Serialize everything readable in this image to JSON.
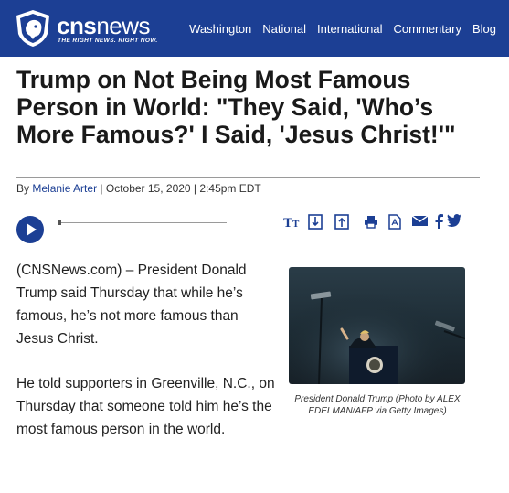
{
  "header": {
    "logo_text_bold": "cns",
    "logo_text_light": "news",
    "tagline": "THE RIGHT NEWS. RIGHT NOW.",
    "background_color": "#1c3f94",
    "nav": [
      "Washington",
      "National",
      "International",
      "Commentary",
      "Blog"
    ]
  },
  "article": {
    "title": "Trump on Not Being Most Famous Person in World: \"They Said, 'Who’s More Famous?' I Said, 'Jesus Christ!'\"",
    "byline_prefix": "By",
    "author": "Melanie Arter",
    "date_sep": " | ",
    "date": "October 15, 2020",
    "time_sep": " | ",
    "time": "2:45pm EDT",
    "paragraphs": [
      "(CNSNews.com) – President Donald Trump said Thursday that while he’s famous, he’s not more famous than Jesus Christ.",
      "He told supporters in Greenville, N.C., on Thursday that someone told him he’s the most famous person in the world."
    ],
    "photo_caption": "President Donald Trump (Photo by ALEX EDELMAN/AFP via Getty Images)"
  },
  "audio": {
    "progress": 0
  },
  "toolbar_icons": [
    "text-size-icon",
    "download-icon",
    "upload-icon",
    "print-icon",
    "pdf-icon",
    "email-icon",
    "facebook-icon",
    "twitter-icon"
  ]
}
